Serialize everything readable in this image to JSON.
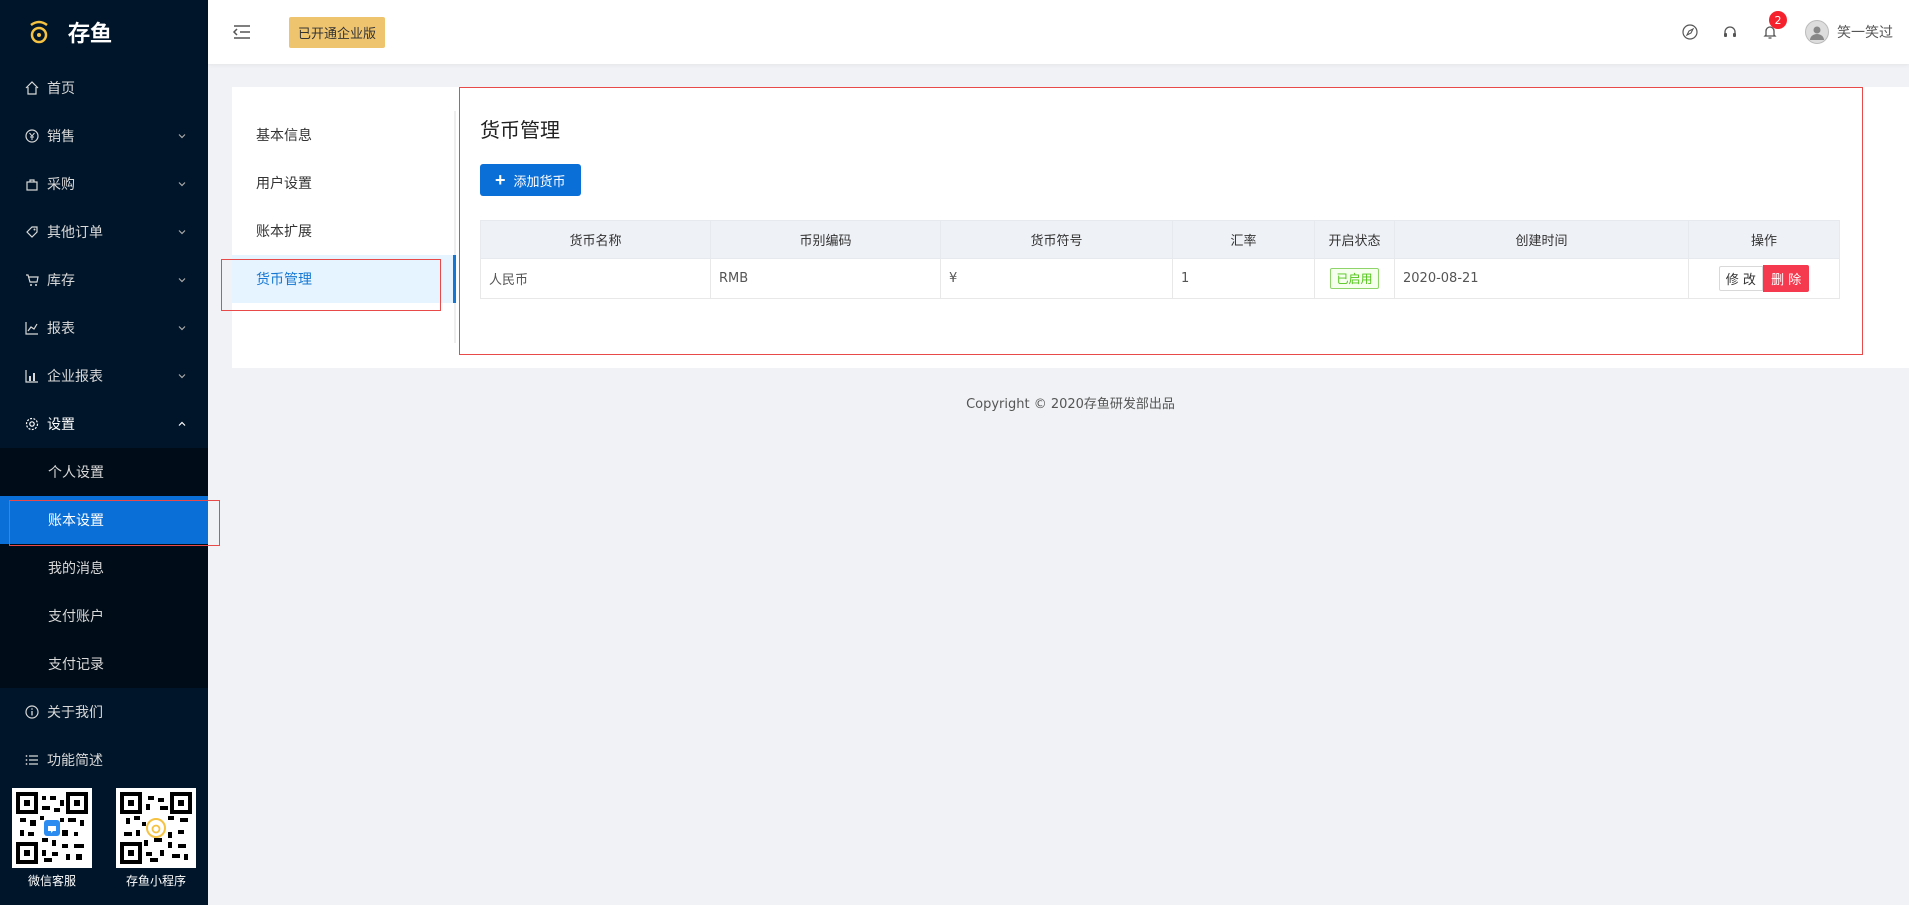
{
  "app": {
    "name": "存鱼"
  },
  "sidebar": {
    "items": [
      {
        "label": "首页",
        "icon": "home-icon"
      },
      {
        "label": "销售",
        "icon": "yen-circle-icon"
      },
      {
        "label": "采购",
        "icon": "bag-icon"
      },
      {
        "label": "其他订单",
        "icon": "tag-icon"
      },
      {
        "label": "库存",
        "icon": "cart-icon"
      },
      {
        "label": "报表",
        "icon": "line-chart-icon"
      },
      {
        "label": "企业报表",
        "icon": "bar-chart-icon"
      },
      {
        "label": "设置",
        "icon": "gear-icon"
      }
    ],
    "settings_sub": [
      "个人设置",
      "账本设置",
      "我的消息",
      "支付账户",
      "支付记录"
    ],
    "bottom_items": [
      {
        "label": "关于我们",
        "icon": "info-icon"
      },
      {
        "label": "功能简述",
        "icon": "list-icon"
      }
    ],
    "qr": [
      {
        "label": "微信客服"
      },
      {
        "label": "存鱼小程序"
      }
    ]
  },
  "header": {
    "badge": "已开通企业版",
    "notification_count": "2",
    "user_name": "笑一笑过"
  },
  "leftnav": {
    "items": [
      "基本信息",
      "用户设置",
      "账本扩展",
      "货币管理"
    ],
    "active_index": 3
  },
  "main": {
    "title": "货币管理",
    "add_button": "添加货币",
    "table": {
      "headers": [
        "货币名称",
        "币别编码",
        "货币符号",
        "汇率",
        "开启状态",
        "创建时间",
        "操作"
      ],
      "rows": [
        {
          "name": "人民币",
          "code": "RMB",
          "symbol": "¥",
          "rate": "1",
          "status": "已启用",
          "created": "2020-08-21",
          "edit": "修 改",
          "delete": "删 除"
        }
      ]
    }
  },
  "footer": {
    "text": "Copyright © 2020存鱼研发部出品"
  },
  "colors": {
    "sidebar_bg": "#001529",
    "primary": "#0b6fd8",
    "danger": "#f5394e",
    "badge": "#efc46f"
  }
}
